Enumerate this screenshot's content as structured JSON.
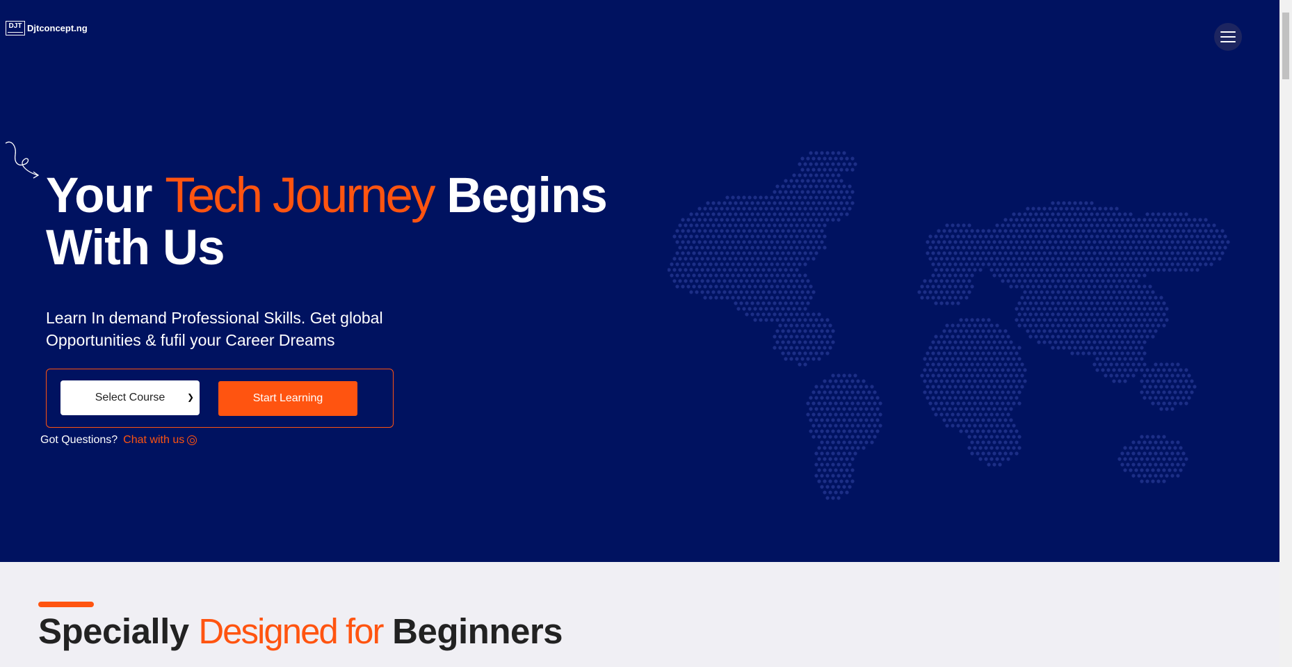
{
  "brand": {
    "logo_mark": "DJT",
    "name": "Djtconcept.ng"
  },
  "header": {
    "menu_icon": "hamburger-menu-icon"
  },
  "hero": {
    "title_part1": "Your ",
    "title_accent": "Tech Journey",
    "title_part2": " Begins With Us",
    "subtitle": "Learn In demand Professional Skills. Get global Opportunities & fufil your Career Dreams",
    "course_select": {
      "selected": "Select Course"
    },
    "start_button": "Start Learning",
    "questions_label": "Got Questions?",
    "chat_link": "Chat with us",
    "chat_icon": "whatsapp-icon",
    "background_graphic": "world-map-dots"
  },
  "section": {
    "title_part1": "Specially ",
    "title_accent": "Designed for",
    "title_part2": " Beginners"
  },
  "colors": {
    "hero_bg": "#001260",
    "accent": "#ff5410",
    "text_light": "#ffffff",
    "page_bg": "#f0eff4",
    "heading_dark": "#222222"
  }
}
